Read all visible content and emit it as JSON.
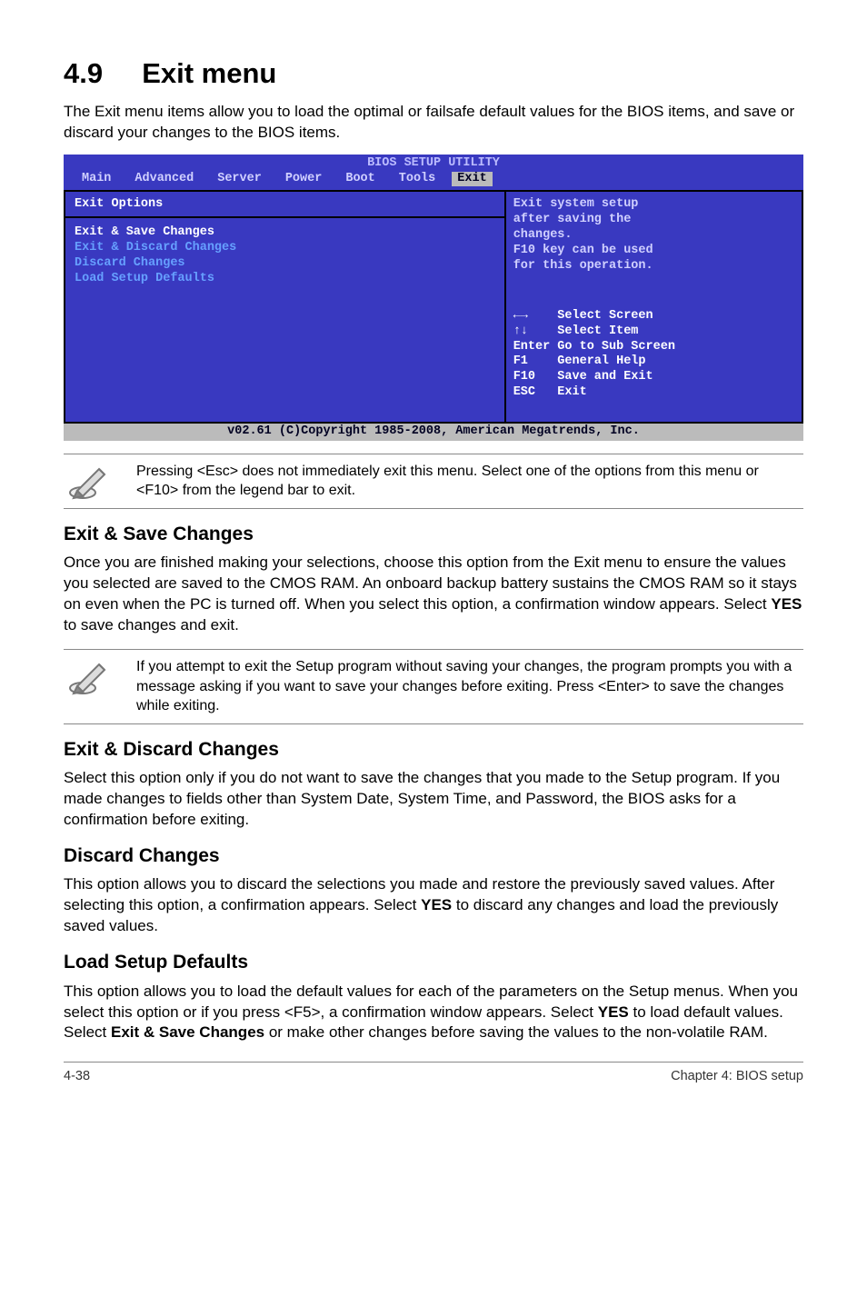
{
  "title_number": "4.9",
  "title_text": "Exit menu",
  "intro": "The Exit menu items allow you to load the optimal or failsafe default values for the BIOS items, and save or discard your changes to the BIOS items.",
  "bios": {
    "header": "BIOS SETUP UTILITY",
    "tabs": [
      "Main",
      "Advanced",
      "Server",
      "Power",
      "Boot",
      "Tools",
      "Exit"
    ],
    "left": {
      "title": "Exit Options",
      "items": [
        "Exit & Save Changes",
        "Exit & Discard Changes",
        "Discard Changes",
        "",
        "Load Setup Defaults"
      ]
    },
    "right": {
      "help1": "Exit system setup",
      "help2": "after saving the",
      "help3": "changes.",
      "help4": "",
      "help5": "F10 key can be used",
      "help6": "for this operation.",
      "k1": "←→    Select Screen",
      "k2": "↑↓    Select Item",
      "k3": "Enter Go to Sub Screen",
      "k4": "F1    General Help",
      "k5": "F10   Save and Exit",
      "k6": "ESC   Exit"
    },
    "footer": "v02.61 (C)Copyright 1985-2008, American Megatrends, Inc."
  },
  "note1": "Pressing <Esc> does not immediately exit this menu. Select one of the options from this menu or <F10> from the legend bar to exit.",
  "sections": {
    "s1": {
      "h": "Exit & Save Changes",
      "p": "Once you are finished making your selections, choose this option from the Exit menu to ensure the values you selected are saved to the CMOS RAM. An onboard backup battery sustains the CMOS RAM so it stays on even when the PC is turned off. When you select this option, a confirmation window appears. Select ",
      "bold": "YES",
      "p2": " to save changes and exit."
    },
    "note2": "If you attempt to exit the Setup program without saving your changes, the program prompts you with a message asking if you want to save your changes before exiting. Press <Enter> to save the changes while exiting.",
    "s2": {
      "h": "Exit & Discard Changes",
      "p": "Select this option only if you do not want to save the changes that you made to the Setup program. If you made changes to fields other than System Date, System Time, and Password, the BIOS asks for a confirmation before exiting."
    },
    "s3": {
      "h": "Discard Changes",
      "p": "This option allows you to discard the selections you made and restore the previously saved values. After selecting this option, a confirmation appears. Select ",
      "bold": "YES",
      "p2": " to discard any changes and load the previously saved values."
    },
    "s4": {
      "h": "Load Setup Defaults",
      "p": "This option allows you to load the default values for each of the parameters on the Setup menus. When you select this option or if you press <F5>, a confirmation window appears. Select ",
      "bold1": "YES",
      "p2": " to load default values. Select ",
      "bold2": "Exit & Save Changes",
      "p3": " or make other changes before saving the values to the non-volatile RAM."
    }
  },
  "footer": {
    "left": "4-38",
    "right": "Chapter 4: BIOS setup"
  }
}
